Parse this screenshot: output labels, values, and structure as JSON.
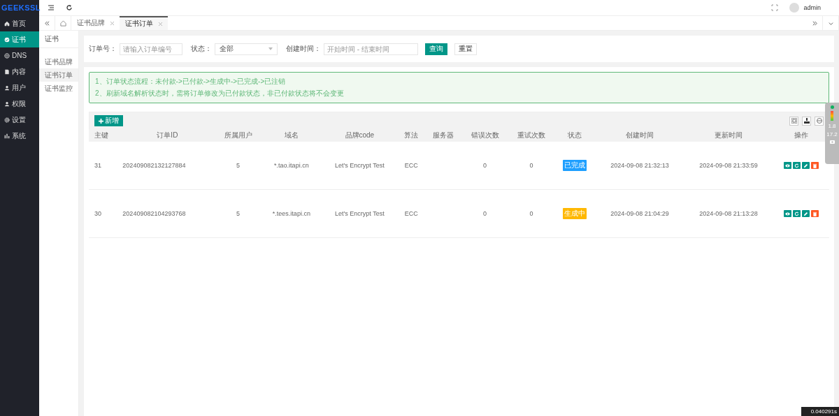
{
  "logo": "GEEKSSL",
  "sidebar": {
    "items": [
      {
        "label": "首页",
        "selected": false
      },
      {
        "label": "证书",
        "selected": true
      },
      {
        "label": "DNS",
        "selected": false
      },
      {
        "label": "内容",
        "selected": false
      },
      {
        "label": "用户",
        "selected": false
      },
      {
        "label": "权限",
        "selected": false
      },
      {
        "label": "设置",
        "selected": false
      },
      {
        "label": "系统",
        "selected": false
      }
    ]
  },
  "header": {
    "user": "admin"
  },
  "tabs": [
    {
      "label": "证书品牌",
      "selected": false
    },
    {
      "label": "证书订单",
      "selected": true
    }
  ],
  "submenu": {
    "title": "证书",
    "items": [
      {
        "label": "证书品牌",
        "selected": false
      },
      {
        "label": "证书订单",
        "selected": true
      },
      {
        "label": "证书监控",
        "selected": false
      }
    ]
  },
  "filters": {
    "order_no": {
      "label": "订单号：",
      "placeholder": "请输入订单编号"
    },
    "status": {
      "label": "状态：",
      "value": "全部"
    },
    "created": {
      "label": "创建时间：",
      "placeholder": "开始时间 - 结束时间"
    },
    "buttons": [
      {
        "label": "查询",
        "kind": "primary"
      },
      {
        "label": "重置",
        "kind": "plain"
      }
    ]
  },
  "notice": [
    "1、订单状态流程：未付款->已付款->生成中->已完成->已注销",
    "2、刷新域名解析状态时，需将订单修改为已付款状态，非已付款状态将不会变更"
  ],
  "toolbar": {
    "add": "新增"
  },
  "table": {
    "columns": [
      "主键",
      "订单ID",
      "所属用户",
      "域名",
      "品牌code",
      "算法",
      "服务器",
      "错误次数",
      "重试次数",
      "状态",
      "创建时间",
      "更新时间",
      "操作"
    ],
    "rows": [
      {
        "cells": [
          "31",
          "202409082132127884",
          "5",
          "*.tao.itapi.cn",
          "Let's Encrypt Test",
          "ECC",
          "",
          "0",
          "0"
        ],
        "status": {
          "text": "已完成",
          "kind": "done"
        },
        "created": "2024-09-08 21:32:13",
        "updated": "2024-09-08 21:33:59"
      },
      {
        "cells": [
          "30",
          "202409082104293768",
          "5",
          "*.tees.itapi.cn",
          "Let's Encrypt Test",
          "ECC",
          "",
          "0",
          "0"
        ],
        "status": {
          "text": "生成中",
          "kind": "generating"
        },
        "created": "2024-09-08 21:04:29",
        "updated": "2024-09-08 21:13:28"
      }
    ]
  },
  "monitor": {
    "readings": [
      "1.8",
      "17.2"
    ]
  },
  "timing": "0.040291s"
}
